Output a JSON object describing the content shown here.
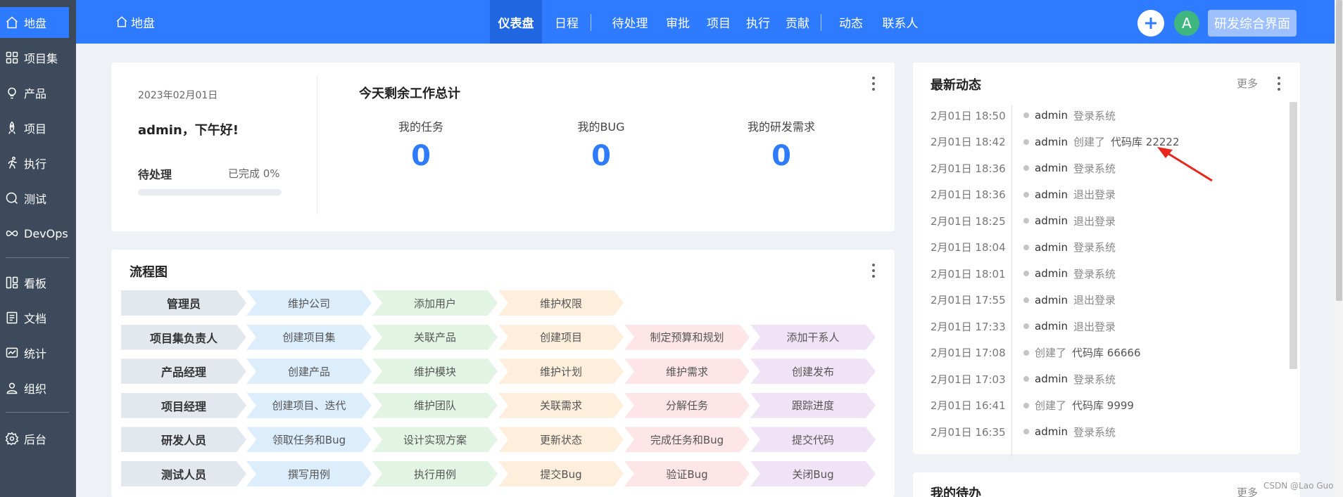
{
  "sidebar": {
    "items": [
      {
        "label": "地盘",
        "icon": "home-icon"
      },
      {
        "label": "项目集",
        "icon": "grid-icon"
      },
      {
        "label": "产品",
        "icon": "lightbulb-icon"
      },
      {
        "label": "项目",
        "icon": "rocket-icon"
      },
      {
        "label": "执行",
        "icon": "run-icon"
      },
      {
        "label": "测试",
        "icon": "magnifier-icon"
      },
      {
        "label": "DevOps",
        "icon": "infinity-icon"
      },
      {
        "label": "看板",
        "icon": "kanban-icon"
      },
      {
        "label": "文档",
        "icon": "document-icon"
      },
      {
        "label": "统计",
        "icon": "chart-icon"
      },
      {
        "label": "组织",
        "icon": "user-icon"
      },
      {
        "label": "后台",
        "icon": "gear-icon"
      }
    ]
  },
  "topbar": {
    "home_label": "地盘",
    "nav": [
      "仪表盘",
      "日程",
      "待处理",
      "审批",
      "项目",
      "执行",
      "贡献",
      "动态",
      "联系人"
    ],
    "active_nav": "仪表盘",
    "avatar_letter": "A",
    "view_button": "研发综合界面",
    "accent_color": "#2e7bff"
  },
  "welcome": {
    "date": "2023年02月01日",
    "greeting": "admin，下午好!",
    "pending_label": "待处理",
    "done_label": "已完成 0%",
    "progress": 0
  },
  "summary": {
    "title": "今天剩余工作总计",
    "stats": [
      {
        "label": "我的任务",
        "value": "0"
      },
      {
        "label": "我的BUG",
        "value": "0"
      },
      {
        "label": "我的研发需求",
        "value": "0"
      }
    ]
  },
  "flowchart": {
    "title": "流程图",
    "rows": [
      {
        "role": "管理员",
        "steps": [
          "维护公司",
          "添加用户",
          "维护权限"
        ]
      },
      {
        "role": "项目集负责人",
        "steps": [
          "创建项目集",
          "关联产品",
          "创建项目",
          "制定预算和规划",
          "添加干系人"
        ]
      },
      {
        "role": "产品经理",
        "steps": [
          "创建产品",
          "维护模块",
          "维护计划",
          "维护需求",
          "创建发布"
        ]
      },
      {
        "role": "项目经理",
        "steps": [
          "创建项目、迭代",
          "维护团队",
          "关联需求",
          "分解任务",
          "跟踪进度"
        ]
      },
      {
        "role": "研发人员",
        "steps": [
          "领取任务和Bug",
          "设计实现方案",
          "更新状态",
          "完成任务和Bug",
          "提交代码"
        ]
      },
      {
        "role": "测试人员",
        "steps": [
          "撰写用例",
          "执行用例",
          "提交Bug",
          "验证Bug",
          "关闭Bug"
        ]
      }
    ],
    "colors": [
      "#e3e8ee",
      "#dcedfc",
      "#e2f4e4",
      "#fdefdc",
      "#fde5e8",
      "#f0e3f6"
    ]
  },
  "activity": {
    "title": "最新动态",
    "more": "更多",
    "items": [
      {
        "time": "2月01日 18:50",
        "user": "admin",
        "action": "登录系统",
        "object": ""
      },
      {
        "time": "2月01日 18:42",
        "user": "admin",
        "action": "创建了",
        "object": "代码库 22222"
      },
      {
        "time": "2月01日 18:36",
        "user": "admin",
        "action": "登录系统",
        "object": ""
      },
      {
        "time": "2月01日 18:36",
        "user": "admin",
        "action": "退出登录",
        "object": ""
      },
      {
        "time": "2月01日 18:25",
        "user": "admin",
        "action": "退出登录",
        "object": ""
      },
      {
        "time": "2月01日 18:04",
        "user": "admin",
        "action": "登录系统",
        "object": ""
      },
      {
        "time": "2月01日 18:01",
        "user": "admin",
        "action": "登录系统",
        "object": ""
      },
      {
        "time": "2月01日 17:55",
        "user": "admin",
        "action": "退出登录",
        "object": ""
      },
      {
        "time": "2月01日 17:33",
        "user": "admin",
        "action": "退出登录",
        "object": ""
      },
      {
        "time": "2月01日 17:08",
        "user": "",
        "action": "创建了",
        "object": "代码库 66666"
      },
      {
        "time": "2月01日 17:03",
        "user": "admin",
        "action": "登录系统",
        "object": ""
      },
      {
        "time": "2月01日 16:41",
        "user": "",
        "action": "创建了",
        "object": "代码库 9999"
      },
      {
        "time": "2月01日 16:35",
        "user": "admin",
        "action": "登录系统",
        "object": ""
      }
    ]
  },
  "todo": {
    "title": "我的待办",
    "more": "更多"
  },
  "watermark": "CSDN @Lao Guo"
}
